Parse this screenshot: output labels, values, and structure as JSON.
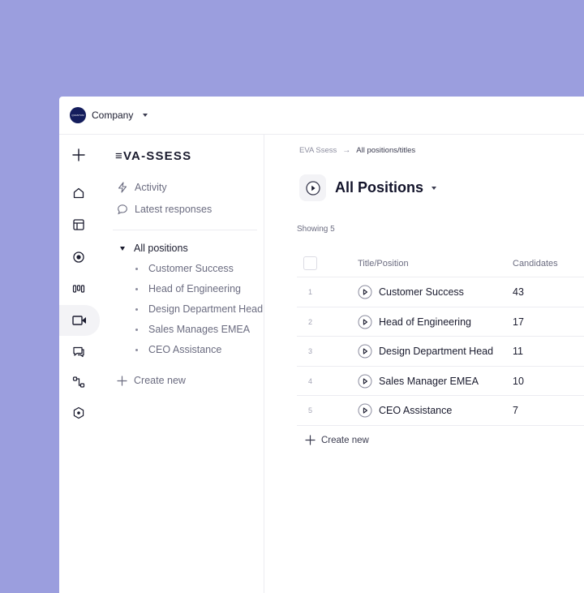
{
  "topbar": {
    "company": "Company",
    "logo_text": "QUANTUM"
  },
  "brand": "≡VA-SSESS",
  "sidebar": {
    "activity": "Activity",
    "latest": "Latest responses",
    "group": "All positions",
    "items": [
      "Customer Success",
      "Head of Engineering",
      "Design Department Head",
      "Sales Manages EMEA",
      "CEO Assistance"
    ],
    "create": "Create new"
  },
  "main": {
    "breadcrumb": [
      "EVA Ssess",
      "All positions/titles"
    ],
    "title": "All Positions",
    "showing": "Showing 5",
    "columns": {
      "title": "Title/Position",
      "candidates": "Candidates"
    },
    "rows": [
      {
        "num": "1",
        "name": "Customer Success",
        "count": "43"
      },
      {
        "num": "2",
        "name": "Head of Engineering",
        "count": "17"
      },
      {
        "num": "3",
        "name": "Design Department Head",
        "count": "11"
      },
      {
        "num": "4",
        "name": "Sales Manager EMEA",
        "count": "10"
      },
      {
        "num": "5",
        "name": "CEO Assistance",
        "count": "7"
      }
    ],
    "create": "Create new"
  },
  "icons": [
    "plus-icon",
    "home-icon",
    "layout-icon",
    "disc-icon",
    "bars-icon",
    "video-icon",
    "chat-icon",
    "flow-icon",
    "hexagon-icon",
    "bolt-icon",
    "message-icon",
    "play-icon"
  ],
  "colors": {
    "background": "#9b9ede",
    "logo": "#141d5c",
    "text": "#1a1b2e",
    "muted": "#6b6c80"
  }
}
